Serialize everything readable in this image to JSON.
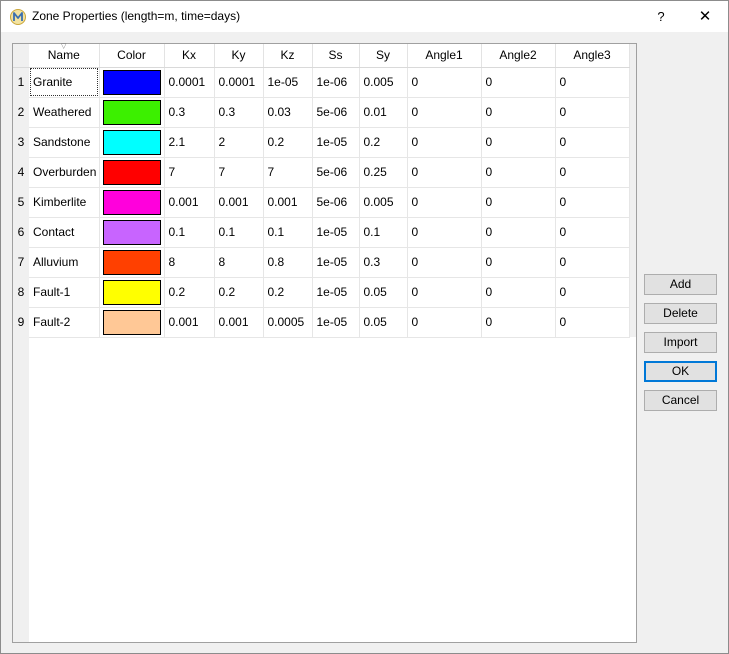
{
  "window": {
    "title": "Zone Properties (length=m, time=days)",
    "help_label": "?",
    "close_label": "✕",
    "app_icon": "modflow-m-icon"
  },
  "table": {
    "columns": [
      "Name",
      "Color",
      "Kx",
      "Ky",
      "Kz",
      "Ss",
      "Sy",
      "Angle1",
      "Angle2",
      "Angle3"
    ],
    "rows": [
      {
        "num": "1",
        "name": "Granite",
        "color": "#0000ff",
        "kx": "0.0001",
        "ky": "0.0001",
        "kz": "1e-05",
        "ss": "1e-06",
        "sy": "0.005",
        "a1": "0",
        "a2": "0",
        "a3": "0"
      },
      {
        "num": "2",
        "name": "Weathered",
        "color": "#3cf000",
        "kx": "0.3",
        "ky": "0.3",
        "kz": "0.03",
        "ss": "5e-06",
        "sy": "0.01",
        "a1": "0",
        "a2": "0",
        "a3": "0"
      },
      {
        "num": "3",
        "name": "Sandstone",
        "color": "#00ffff",
        "kx": "2.1",
        "ky": "2",
        "kz": "0.2",
        "ss": "1e-05",
        "sy": "0.2",
        "a1": "0",
        "a2": "0",
        "a3": "0"
      },
      {
        "num": "4",
        "name": "Overburden",
        "color": "#ff0000",
        "kx": "7",
        "ky": "7",
        "kz": "7",
        "ss": "5e-06",
        "sy": "0.25",
        "a1": "0",
        "a2": "0",
        "a3": "0"
      },
      {
        "num": "5",
        "name": "Kimberlite",
        "color": "#ff00dc",
        "kx": "0.001",
        "ky": "0.001",
        "kz": "0.001",
        "ss": "5e-06",
        "sy": "0.005",
        "a1": "0",
        "a2": "0",
        "a3": "0"
      },
      {
        "num": "6",
        "name": "Contact",
        "color": "#c864ff",
        "kx": "0.1",
        "ky": "0.1",
        "kz": "0.1",
        "ss": "1e-05",
        "sy": "0.1",
        "a1": "0",
        "a2": "0",
        "a3": "0"
      },
      {
        "num": "7",
        "name": "Alluvium",
        "color": "#ff4000",
        "kx": "8",
        "ky": "8",
        "kz": "0.8",
        "ss": "1e-05",
        "sy": "0.3",
        "a1": "0",
        "a2": "0",
        "a3": "0"
      },
      {
        "num": "8",
        "name": "Fault-1",
        "color": "#ffff00",
        "kx": "0.2",
        "ky": "0.2",
        "kz": "0.2",
        "ss": "1e-05",
        "sy": "0.05",
        "a1": "0",
        "a2": "0",
        "a3": "0"
      },
      {
        "num": "9",
        "name": "Fault-2",
        "color": "#ffc896",
        "kx": "0.001",
        "ky": "0.001",
        "kz": "0.0005",
        "ss": "1e-05",
        "sy": "0.05",
        "a1": "0",
        "a2": "0",
        "a3": "0"
      }
    ]
  },
  "buttons": {
    "add": "Add",
    "delete": "Delete",
    "import": "Import",
    "ok": "OK",
    "cancel": "Cancel"
  }
}
